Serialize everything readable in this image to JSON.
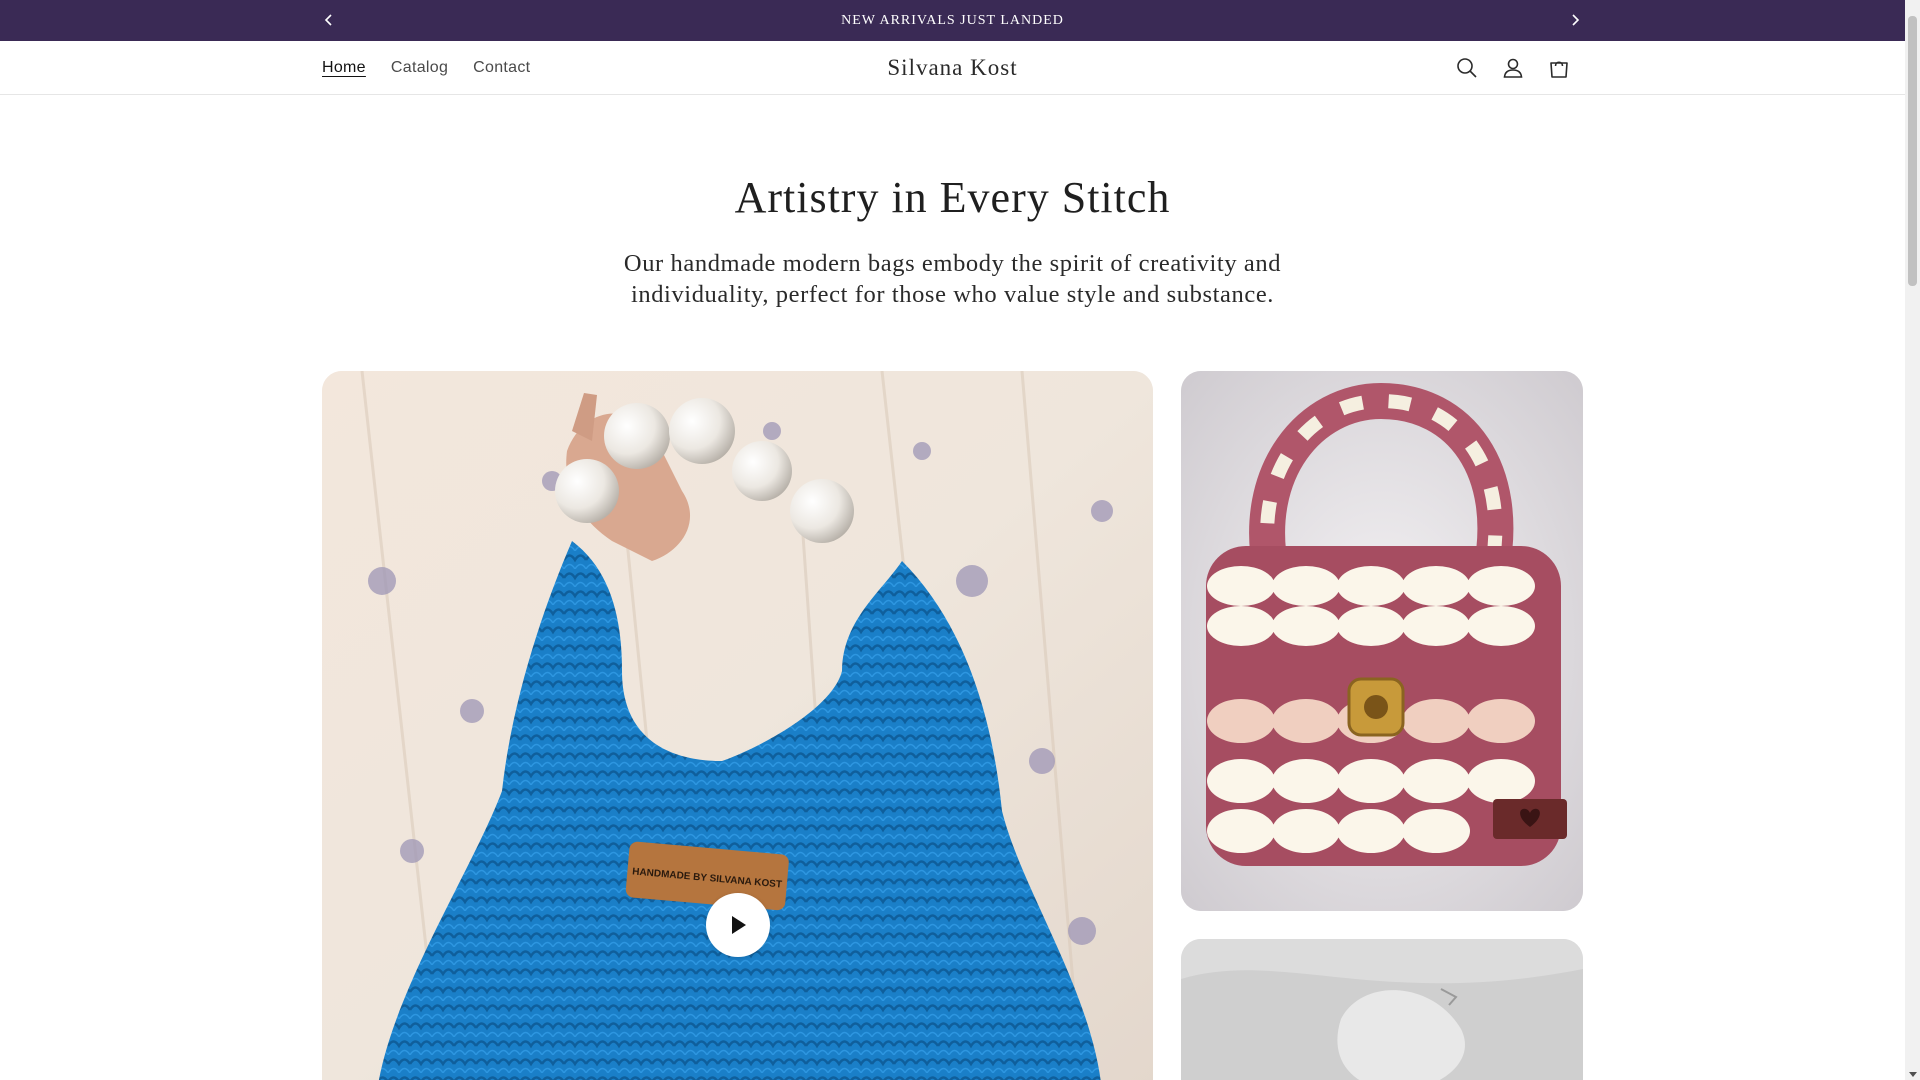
{
  "announcement": {
    "text": "NEW ARRIVALS JUST LANDED",
    "prev_icon": "chevron-left-icon",
    "next_icon": "chevron-right-icon"
  },
  "header": {
    "brand": "Silvana Kost",
    "nav": [
      {
        "label": "Home",
        "active": true
      },
      {
        "label": "Catalog",
        "active": false
      },
      {
        "label": "Contact",
        "active": false
      }
    ],
    "icons": [
      "search-icon",
      "account-icon",
      "cart-icon"
    ]
  },
  "hero": {
    "title": "Artistry in Every Stitch",
    "subtitle": "Our handmade modern bags embody the spirit of creativity and individuality, perfect for those who value style and substance."
  },
  "media": {
    "video_label_text": "HANDMADE BY SILVANA KOST",
    "play_icon": "play-icon"
  },
  "colors": {
    "announcement_bg": "#3a2a55",
    "bag_blue": "#1a7fc8",
    "bag_rose": "#b0566a",
    "bag_cream": "#f5efe0"
  }
}
